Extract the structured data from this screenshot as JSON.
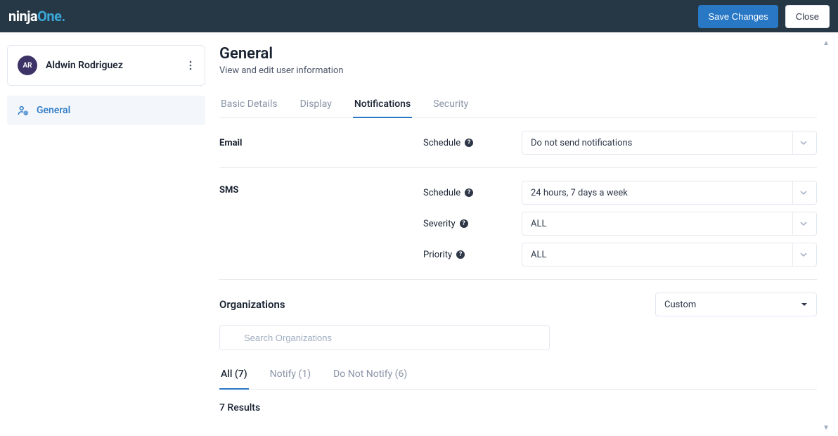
{
  "header": {
    "brand_a": "ninja",
    "brand_b": "One",
    "save_label": "Save Changes",
    "close_label": "Close"
  },
  "sidebar": {
    "avatar_initials": "AR",
    "user_name": "Aldwin Rodriguez",
    "items": [
      {
        "label": "General"
      }
    ]
  },
  "page": {
    "title": "General",
    "subtitle": "View and edit user information"
  },
  "tabs": {
    "basic": "Basic Details",
    "display": "Display",
    "notifications": "Notifications",
    "security": "Security"
  },
  "email": {
    "label": "Email",
    "schedule_label": "Schedule",
    "schedule_value": "Do not send notifications"
  },
  "sms": {
    "label": "SMS",
    "schedule_label": "Schedule",
    "schedule_value": "24 hours, 7 days a week",
    "severity_label": "Severity",
    "severity_value": "ALL",
    "priority_label": "Priority",
    "priority_value": "ALL"
  },
  "orgs": {
    "title": "Organizations",
    "mode_value": "Custom",
    "search_placeholder": "Search Organizations",
    "filter_all": "All (7)",
    "filter_notify": "Notify (1)",
    "filter_dont": "Do Not Notify (6)",
    "results": "7 Results"
  }
}
